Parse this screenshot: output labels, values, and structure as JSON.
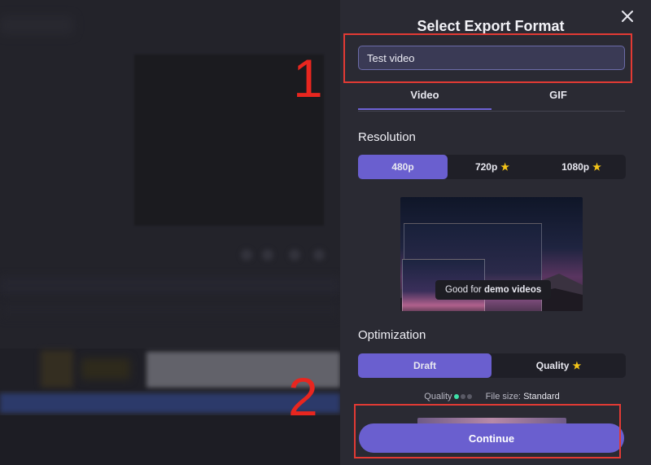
{
  "dialog": {
    "title": "Select Export Format",
    "close_icon": "close-icon",
    "name_input_value": "Test video"
  },
  "tabs": [
    {
      "label": "Video",
      "active": true
    },
    {
      "label": "GIF",
      "active": false
    }
  ],
  "resolution": {
    "label": "Resolution",
    "options": [
      {
        "label": "480p",
        "selected": true,
        "premium": false
      },
      {
        "label": "720p",
        "selected": false,
        "premium": true
      },
      {
        "label": "1080p",
        "selected": false,
        "premium": true
      }
    ],
    "premium_icon": "star-icon"
  },
  "preview": {
    "caption_prefix": "Good for",
    "caption_bold": "demo videos"
  },
  "optimization": {
    "label": "Optimization",
    "options": [
      {
        "label": "Draft",
        "selected": true,
        "premium": false
      },
      {
        "label": "Quality",
        "selected": false,
        "premium": true
      }
    ]
  },
  "quality_info": {
    "quality_label": "Quality",
    "quality_level": "1 of 3",
    "file_size_label": "File size:",
    "file_size_value": "Standard"
  },
  "continue_label": "Continue",
  "annotations": {
    "step1": "1",
    "step2": "2"
  },
  "colors": {
    "accent": "#6a5fcf",
    "panel_bg": "#2a2a33",
    "annotation_red": "#e23a34",
    "star": "#f5c518",
    "quality_dot_on": "#3ee0a8"
  }
}
